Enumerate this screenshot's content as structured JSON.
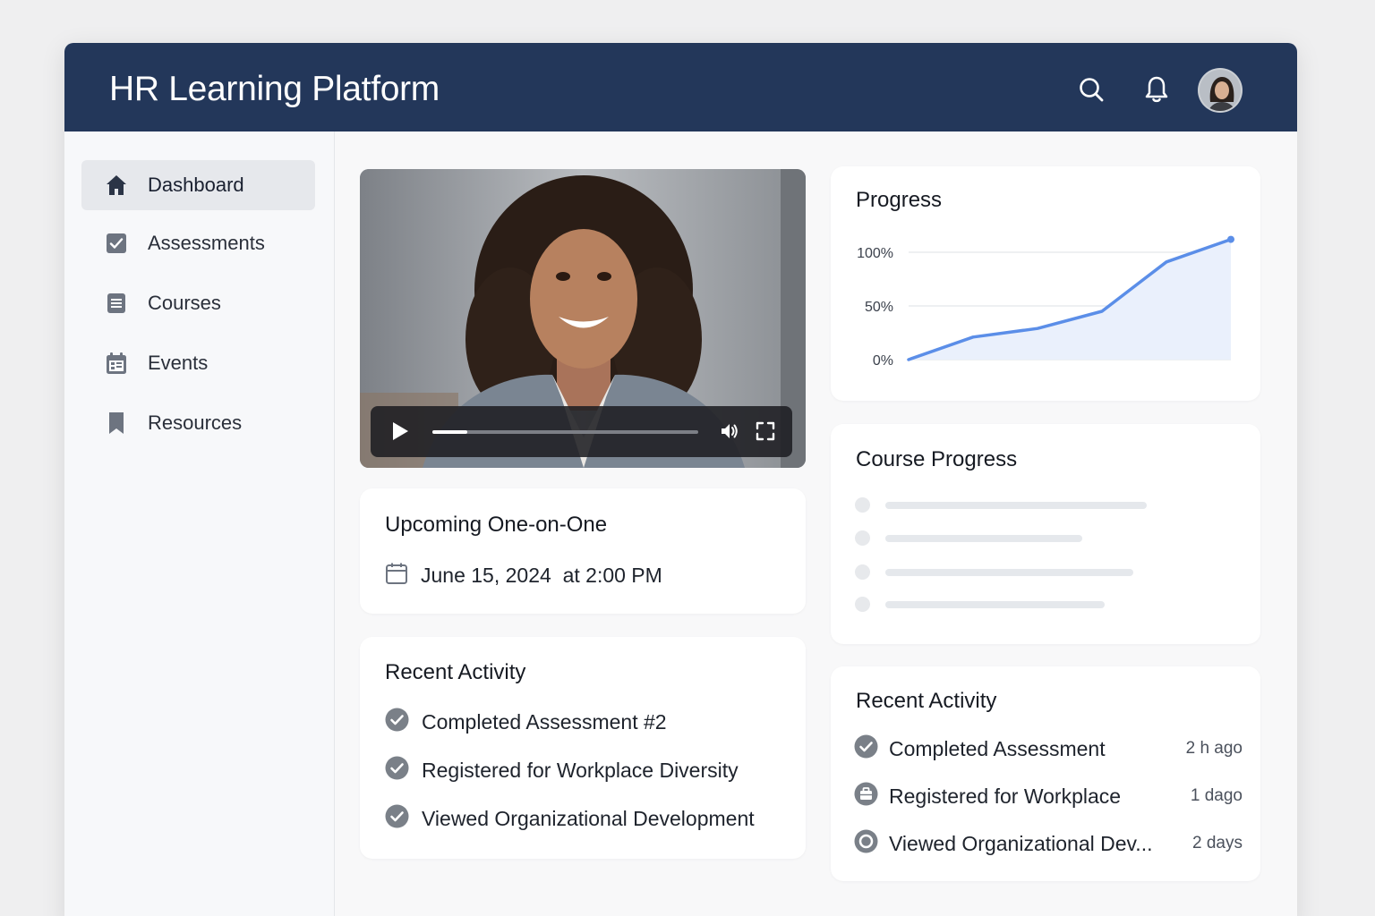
{
  "app": {
    "title": "HR Learning Platform",
    "accent_color": "#23375a"
  },
  "header": {
    "search_icon": "search-icon",
    "notifications_icon": "bell-icon",
    "avatar": "user-avatar"
  },
  "sidebar": {
    "items": [
      {
        "label": "Dashboard",
        "icon": "home-icon",
        "active": true
      },
      {
        "label": "Assessments",
        "icon": "checkbox-icon",
        "active": false
      },
      {
        "label": "Courses",
        "icon": "document-icon",
        "active": false
      },
      {
        "label": "Events",
        "icon": "calendar-icon",
        "active": false
      },
      {
        "label": "Resources",
        "icon": "bookmark-icon",
        "active": false
      }
    ]
  },
  "video": {
    "subject": "video-person",
    "progress": 0.13,
    "controls": [
      "play-icon",
      "volume-icon",
      "fullscreen-icon"
    ]
  },
  "one_on_one": {
    "title": "Upcoming One-on-One",
    "datetime": "June 15, 2024  at 2:00 PM"
  },
  "recent_activity_left": {
    "title": "Recent Activity",
    "items": [
      {
        "text": "Completed Assessment #2",
        "icon": "check-circle-icon"
      },
      {
        "text": "Registered for Workplace Diversity",
        "icon": "check-circle-icon"
      },
      {
        "text": "Viewed Organizational Development",
        "icon": "check-circle-icon"
      }
    ]
  },
  "progress": {
    "title": "Progress"
  },
  "chart_data": {
    "type": "area",
    "title": "Progress",
    "y_tick_labels": [
      "100%",
      "50%",
      "0%"
    ],
    "ylim": [
      0,
      100
    ],
    "x": [
      0,
      1,
      2,
      3,
      4,
      5,
      6
    ],
    "values": [
      0,
      21,
      29,
      45,
      91,
      112
    ],
    "line_color": "#5b8ee8",
    "fill_color": "#eaf0fc",
    "grid": true,
    "legend": "none"
  },
  "course_progress": {
    "title": "Course Progress",
    "items": [
      0.81,
      0.61,
      0.77,
      0.68
    ]
  },
  "recent_activity_right": {
    "title": "Recent Activity",
    "items": [
      {
        "text": "Completed Assessment",
        "time": "2 h ago",
        "icon": "check-circle-icon"
      },
      {
        "text": "Registered for Workplace",
        "time": "1 dago",
        "icon": "briefcase-icon"
      },
      {
        "text": "Viewed Organizational Dev...",
        "time": "2 days",
        "icon": "record-circle-icon"
      }
    ]
  }
}
